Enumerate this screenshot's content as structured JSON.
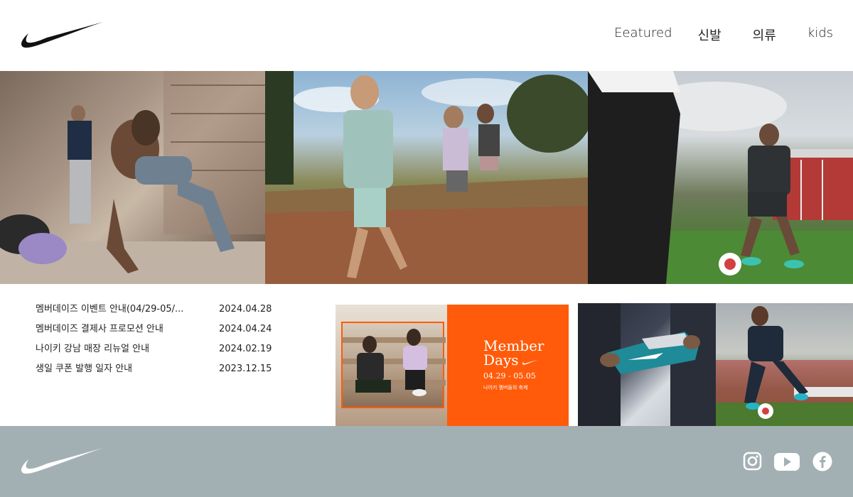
{
  "header": {
    "logo": "nike-swoosh",
    "nav": [
      {
        "label": "Eeatured"
      },
      {
        "label": "신발"
      },
      {
        "label": "의류"
      },
      {
        "label": "kids"
      }
    ]
  },
  "hero": {
    "panels": [
      "training",
      "trail-running",
      "football"
    ]
  },
  "notices": [
    {
      "title": "멤버데이즈 이벤트 안내(04/29-05/...",
      "date": "2024.04.28"
    },
    {
      "title": "멤버데이즈 결제사 프로모션 안내",
      "date": "2024.04.24"
    },
    {
      "title": "나이키 강남 매장 리뉴얼 안내",
      "date": "2024.02.19"
    },
    {
      "title": "생일 쿠폰 발행 일자 안내",
      "date": "2023.12.15"
    }
  ],
  "banner": {
    "title_line1": "Member",
    "title_line2": "Days",
    "dates": "04.29 - 05.05",
    "subtitle": "나이키 멤버들의 축제",
    "bg_color": "#ff5b0a"
  },
  "footer": {
    "logo": "nike-swoosh",
    "social": [
      "instagram-icon",
      "youtube-icon",
      "facebook-icon"
    ],
    "bg_color": "#a3b0b3"
  }
}
